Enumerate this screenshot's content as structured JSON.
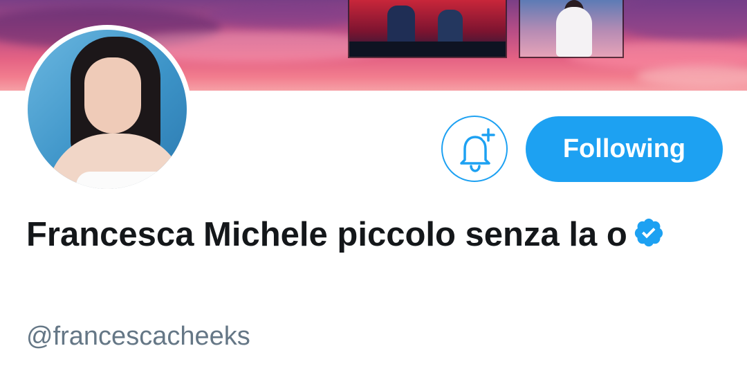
{
  "profile": {
    "display_name": "Francesca Michele piccolo senza la o",
    "handle": "@francescacheeks",
    "verified": true
  },
  "actions": {
    "notifications_icon": "bell-plus-icon",
    "follow_label": "Following"
  },
  "colors": {
    "accent": "#1da1f2",
    "name_text": "#14171a",
    "secondary_text": "#657786"
  }
}
